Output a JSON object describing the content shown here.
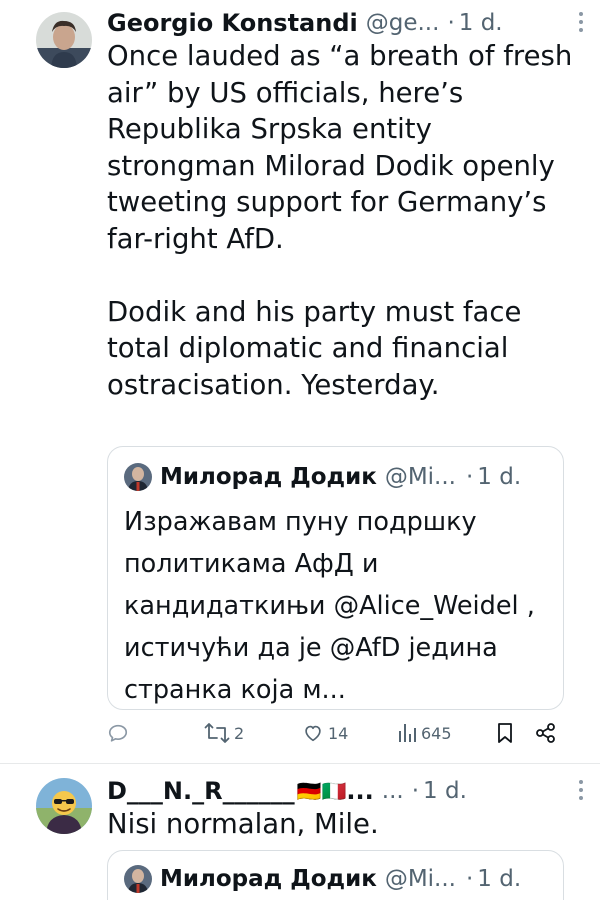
{
  "tweet1": {
    "name": "Georgio Konstandi",
    "handle": "@ge...",
    "dot": "·",
    "time": "1 d.",
    "paragraph1": "Once lauded as “a breath of fresh air” by US officials, here’s Republika Srpska entity strongman Milorad Dodik openly tweeting support for Germany’s far-right AfD.",
    "paragraph2": "Dodik and his party must face total diplomatic and financial ostracisation. Yesterday.",
    "quote": {
      "name": "Милорад Додик",
      "handle": "@Mi...",
      "dot": "·",
      "time": "1 d.",
      "text": "Изражавам пуну подршку политикама АфД и кандидаткињи @Alice_Weidel , истичући да је @AfD једина странка која м..."
    },
    "actions": {
      "replies_icon": "reply-icon",
      "retweets": "2",
      "likes": "14",
      "views": "645",
      "bookmark_icon": "bookmark-icon",
      "share_icon": "share-icon"
    }
  },
  "tweet2": {
    "name": "D___N._R______",
    "flags": "🇩🇪🇮🇹",
    "ellipsis": "...",
    "handle": "...",
    "dot": "·",
    "time": "1 d.",
    "text": "Nisi normalan, Mile.",
    "quote": {
      "name": "Милорад Додик",
      "handle": "@Mi...",
      "dot": "·",
      "time": "1 d."
    }
  }
}
